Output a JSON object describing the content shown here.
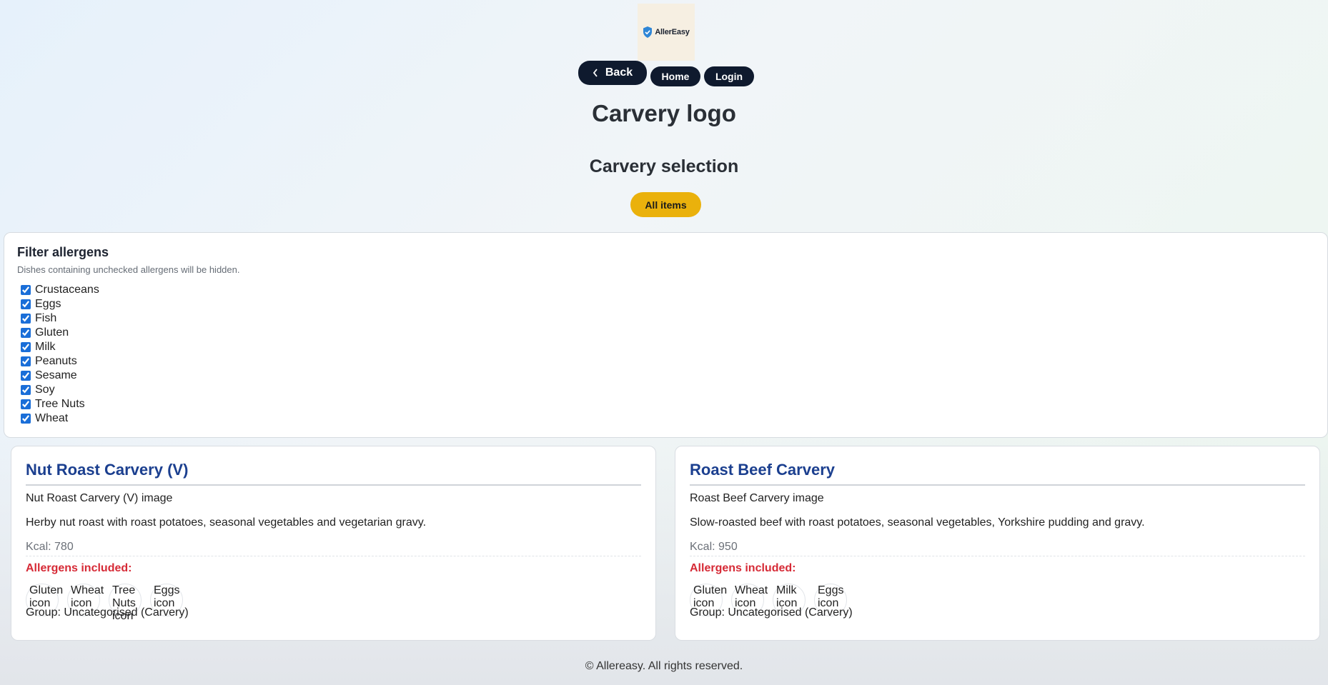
{
  "brand": {
    "name": "AllerEasy"
  },
  "nav": {
    "back": "Back",
    "home": "Home",
    "login": "Login"
  },
  "page": {
    "logo_heading": "Carvery logo",
    "section_heading": "Carvery selection",
    "filter_button": "All items"
  },
  "filter": {
    "title": "Filter allergens",
    "subtitle": "Dishes containing unchecked allergens will be hidden.",
    "allergens": [
      {
        "label": "Crustaceans",
        "checked": true
      },
      {
        "label": "Eggs",
        "checked": true
      },
      {
        "label": "Fish",
        "checked": true
      },
      {
        "label": "Gluten",
        "checked": true
      },
      {
        "label": "Milk",
        "checked": true
      },
      {
        "label": "Peanuts",
        "checked": true
      },
      {
        "label": "Sesame",
        "checked": true
      },
      {
        "label": "Soy",
        "checked": true
      },
      {
        "label": "Tree Nuts",
        "checked": true
      },
      {
        "label": "Wheat",
        "checked": true
      }
    ]
  },
  "dishes": [
    {
      "title": "Nut Roast Carvery (V)",
      "image_alt": "Nut Roast Carvery (V) image",
      "description": "Herby nut roast with roast potatoes, seasonal vegetables and vegetarian gravy.",
      "kcal": "Kcal: 780",
      "allergens_label": "Allergens included:",
      "allergen_icons": [
        "Gluten icon",
        "Wheat icon",
        "Tree Nuts icon",
        "Eggs icon"
      ],
      "group": "Group: Uncategorised (Carvery)"
    },
    {
      "title": "Roast Beef Carvery",
      "image_alt": "Roast Beef Carvery image",
      "description": "Slow-roasted beef with roast potatoes, seasonal vegetables, Yorkshire pudding and gravy.",
      "kcal": "Kcal: 950",
      "allergens_label": "Allergens included:",
      "allergen_icons": [
        "Gluten icon",
        "Wheat icon",
        "Milk icon",
        "Eggs icon"
      ],
      "group": "Group: Uncategorised (Carvery)"
    }
  ],
  "footer": {
    "text": "© Allereasy. All rights reserved."
  },
  "colors": {
    "dark_button": "#0f1a2e",
    "accent_yellow": "#eab10c",
    "title_blue": "#1b3f8f",
    "allergen_red": "#d62a36"
  }
}
